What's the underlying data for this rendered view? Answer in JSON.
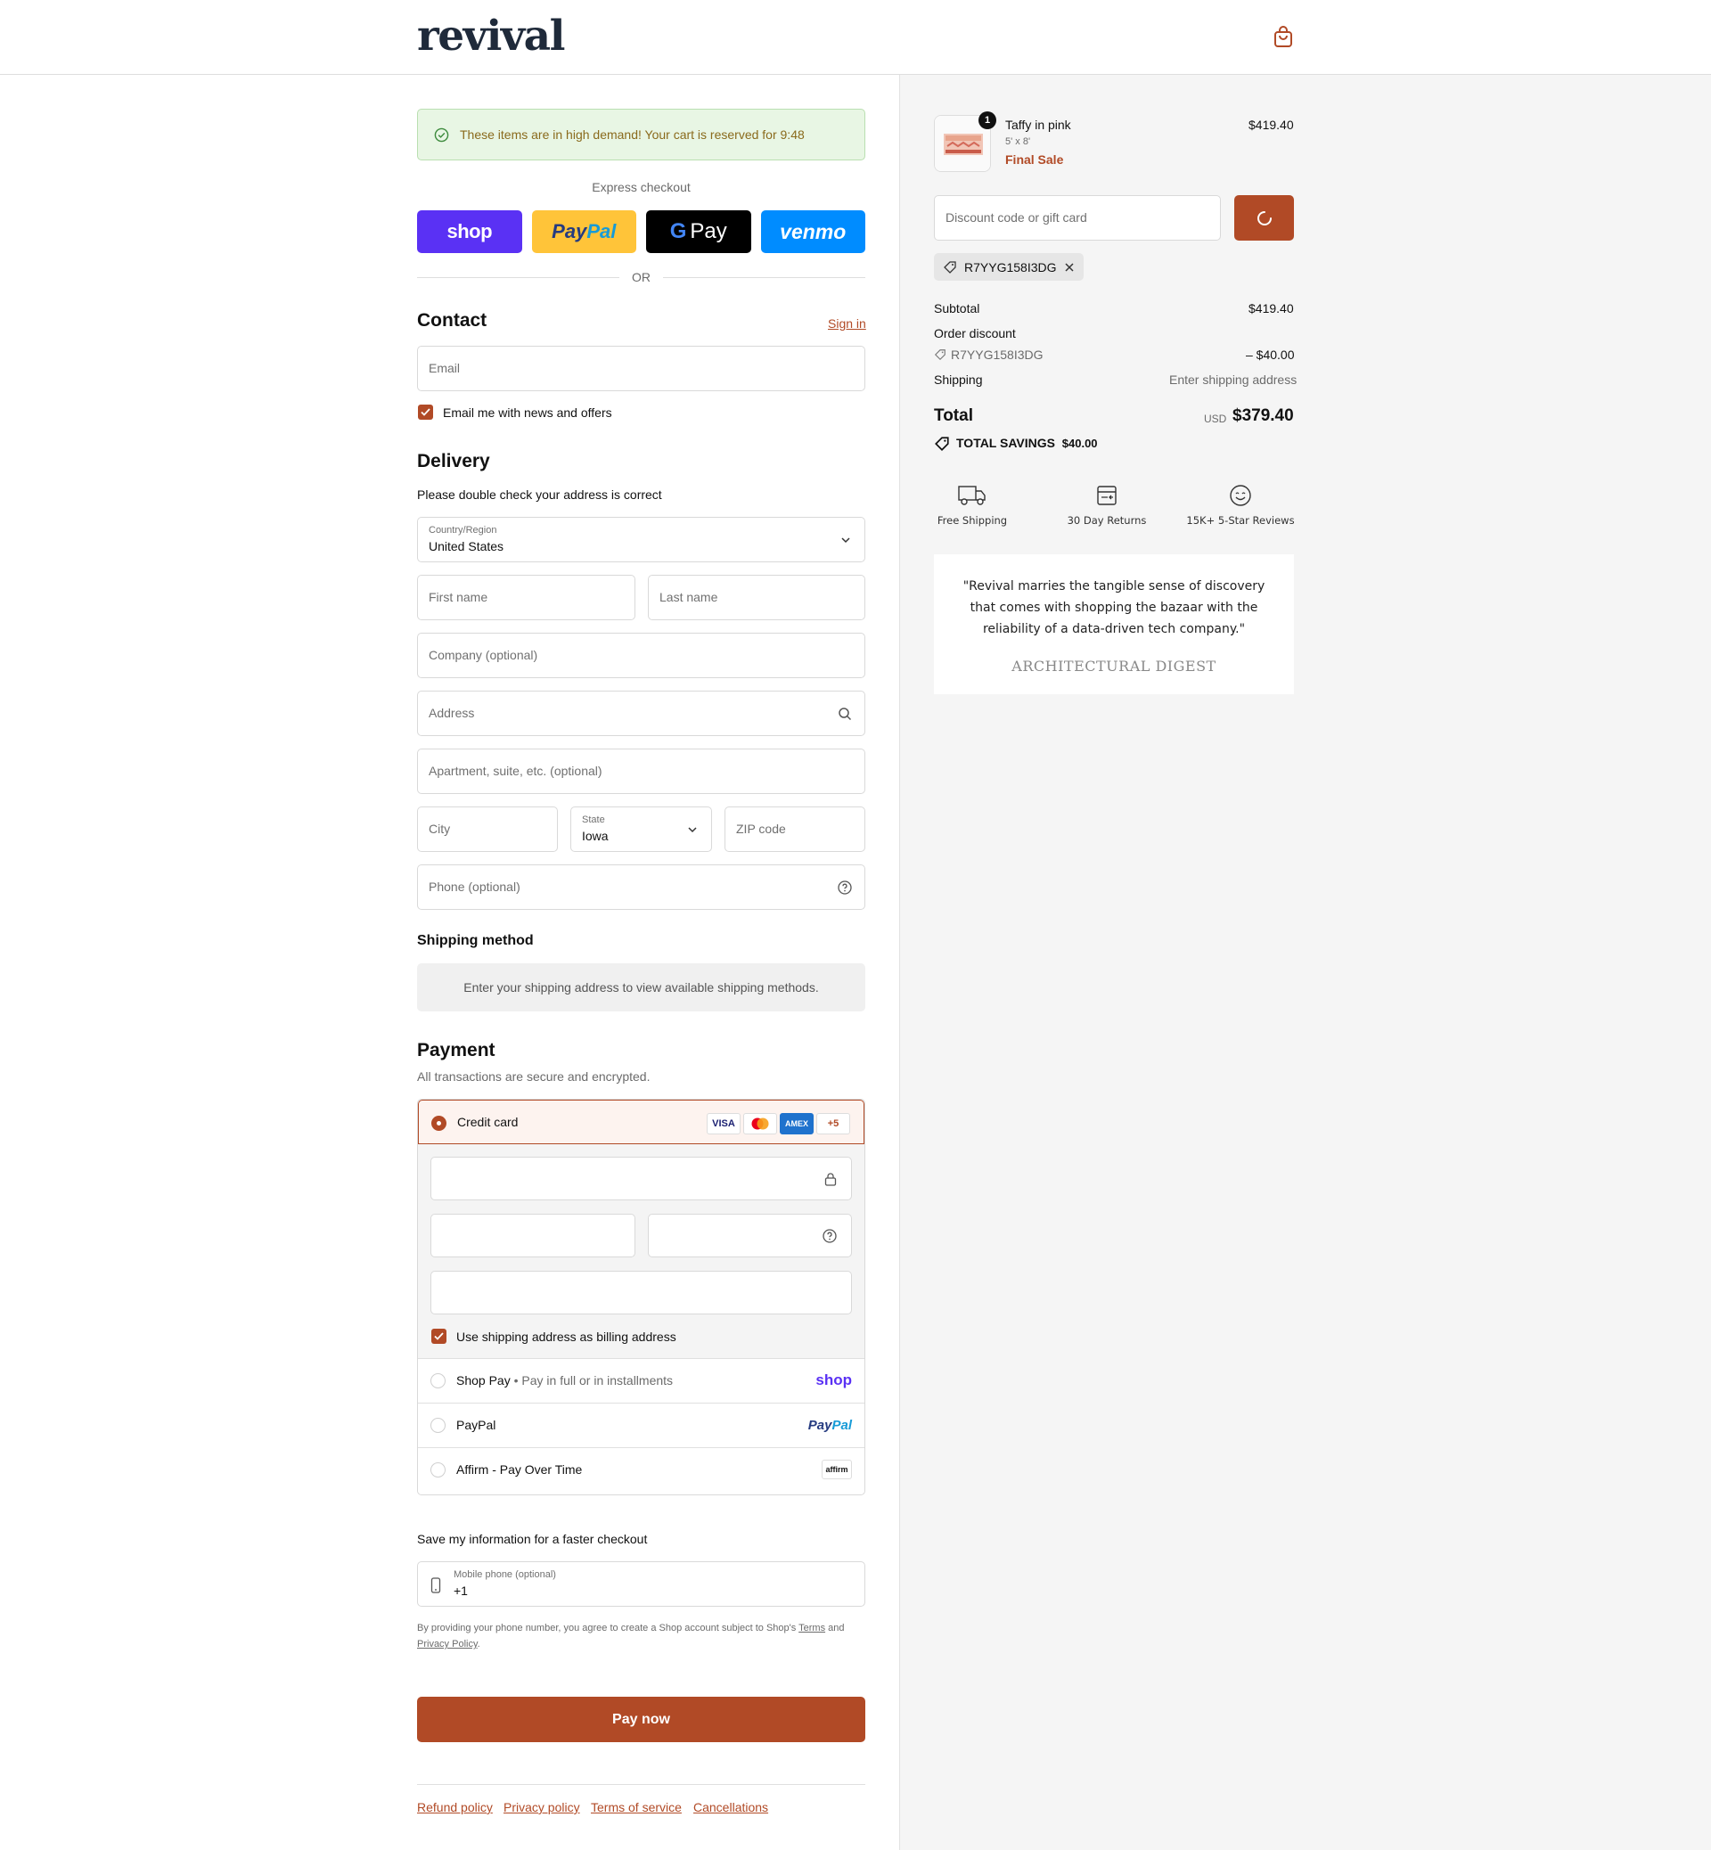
{
  "header": {
    "logo": "revival",
    "cart_icon": "shopping-bag-icon"
  },
  "banner": {
    "text": "These items are in high demand! Your cart is reserved for 9:48",
    "icon": "check-circle-icon"
  },
  "express": {
    "label": "Express checkout",
    "buttons": {
      "shop": "shop",
      "paypal_a": "Pay",
      "paypal_b": "Pal",
      "gpay_g": "G",
      "gpay": "Pay",
      "venmo": "venmo"
    },
    "or": "OR"
  },
  "contact": {
    "title": "Contact",
    "sign_in": "Sign in",
    "email_placeholder": "Email",
    "newsletter_label": "Email me with news and offers",
    "newsletter_checked": true
  },
  "delivery": {
    "title": "Delivery",
    "note": "Please double check your address is correct",
    "country_label": "Country/Region",
    "country_value": "United States",
    "first_name": "First name",
    "last_name": "Last name",
    "company": "Company (optional)",
    "address": "Address",
    "apartment": "Apartment, suite, etc. (optional)",
    "city": "City",
    "state_label": "State",
    "state_value": "Iowa",
    "zip": "ZIP code",
    "phone": "Phone (optional)"
  },
  "shipping_method": {
    "title": "Shipping method",
    "message": "Enter your shipping address to view available shipping methods."
  },
  "payment": {
    "title": "Payment",
    "subtitle": "All transactions are secure and encrypted.",
    "credit_card_label": "Credit card",
    "card_logos": {
      "visa": "VISA",
      "amex": "AMEX",
      "more": "+5"
    },
    "billing_label": "Use shipping address as billing address",
    "billing_checked": true,
    "methods": {
      "shop_pay": "Shop Pay",
      "shop_pay_sub": "Pay in full or in installments",
      "shop_pay_logo": "shop",
      "paypal": "PayPal",
      "paypal_logo_a": "Pay",
      "paypal_logo_b": "Pal",
      "affirm": "Affirm - Pay Over Time",
      "affirm_logo": "affirm"
    }
  },
  "save_info": {
    "title": "Save my information for a faster checkout",
    "mobile_label": "Mobile phone (optional)",
    "mobile_value": "+1",
    "terms_a": "By providing your phone number, you agree to create a Shop account subject to Shop's ",
    "terms_link": "Terms",
    "terms_b": " and ",
    "privacy_link": "Privacy Policy",
    "terms_end": "."
  },
  "pay_now": "Pay now",
  "footer_links": [
    "Refund policy",
    "Privacy policy",
    "Terms of service",
    "Cancellations"
  ],
  "order": {
    "item": {
      "name": "Taffy in pink",
      "size": "5' x 8'",
      "tag": "Final Sale",
      "price": "$419.40",
      "quantity": "1"
    },
    "discount_placeholder": "Discount code or gift card",
    "applied_code": "R7YYG158I3DG",
    "subtotal_label": "Subtotal",
    "subtotal": "$419.40",
    "order_discount_label": "Order discount",
    "discount_code": "R7YYG158I3DG",
    "discount_amount": "– $40.00",
    "shipping_label": "Shipping",
    "shipping_value": "Enter shipping address",
    "total_label": "Total",
    "currency": "USD",
    "total": "$379.40",
    "savings_label": "TOTAL SAVINGS",
    "savings": "$40.00"
  },
  "perks": [
    "Free Shipping",
    "30 Day Returns",
    "15K+ 5-Star Reviews"
  ],
  "testimonial": {
    "quote": "\"Revival marries the tangible sense of discovery that comes with shopping the bazaar with the reliability of a data-driven tech company.\"",
    "source": "ARCHITECTURAL DIGEST"
  },
  "colors": {
    "accent": "#b14a26",
    "banner_bg": "#e8f6e4",
    "banner_text": "#8a6a1c",
    "sidebar_bg": "#f5f5f5"
  }
}
